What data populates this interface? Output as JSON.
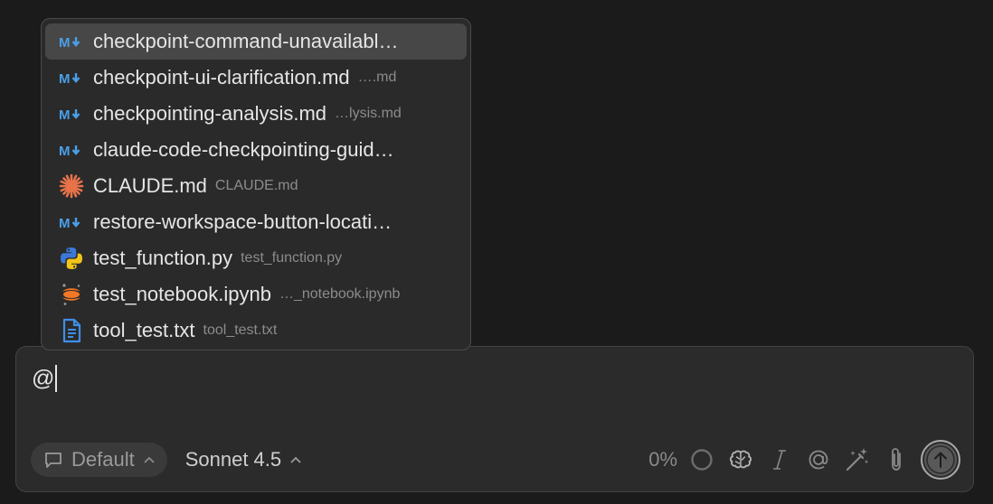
{
  "mention_popup": {
    "items": [
      {
        "name": "checkpoint-command-unavailabl…",
        "path": "",
        "icon": "markdown-icon",
        "selected": true
      },
      {
        "name": "checkpoint-ui-clarification.md",
        "path": "….md",
        "icon": "markdown-icon"
      },
      {
        "name": "checkpointing-analysis.md",
        "path": "…lysis.md",
        "icon": "markdown-icon"
      },
      {
        "name": "claude-code-checkpointing-guid…",
        "path": "",
        "icon": "markdown-icon"
      },
      {
        "name": "CLAUDE.md",
        "path": "CLAUDE.md",
        "icon": "claude-icon"
      },
      {
        "name": "restore-workspace-button-locati…",
        "path": "",
        "icon": "markdown-icon"
      },
      {
        "name": "test_function.py",
        "path": "test_function.py",
        "icon": "python-icon"
      },
      {
        "name": "test_notebook.ipynb",
        "path": "…_notebook.ipynb",
        "icon": "jupyter-icon"
      },
      {
        "name": "tool_test.txt",
        "path": "tool_test.txt",
        "icon": "text-file-icon"
      }
    ]
  },
  "composer": {
    "input_value": "@",
    "mode_label": "Default",
    "model_label": "Sonnet 4.5",
    "context_percent": "0%"
  },
  "colors": {
    "markdown": "#4a9fe8",
    "claude": "#e8734a",
    "python_blue": "#3c78d8",
    "python_yellow": "#f0c419",
    "jupyter": "#f37726"
  }
}
